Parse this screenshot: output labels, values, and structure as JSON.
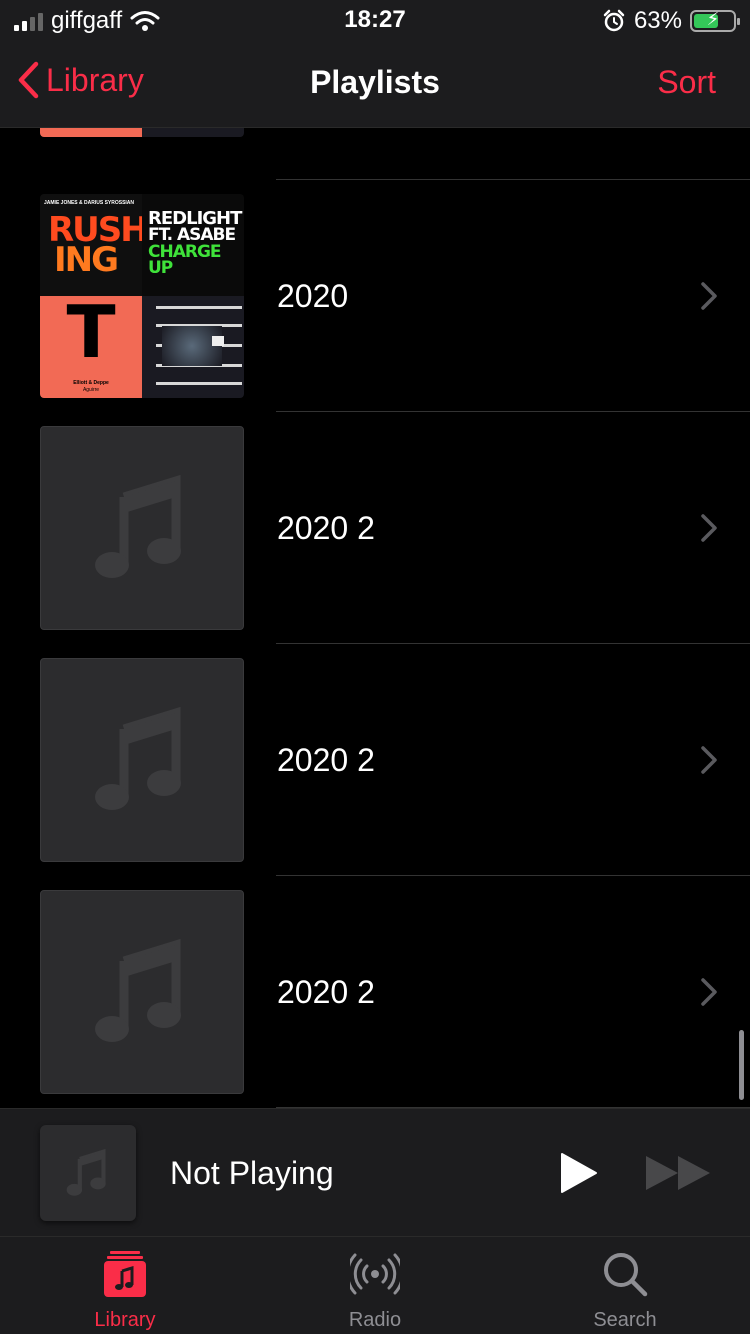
{
  "status_bar": {
    "carrier": "giffgaff",
    "time": "18:27",
    "battery_percent": "63%",
    "battery_level": 0.63
  },
  "nav": {
    "back_label": "Library",
    "title": "Playlists",
    "sort_label": "Sort"
  },
  "playlists": [
    {
      "title": "2020",
      "art": "mosaic"
    },
    {
      "title": "2020 2",
      "art": "placeholder"
    },
    {
      "title": "2020 2",
      "art": "placeholder"
    },
    {
      "title": "2020 2",
      "art": "placeholder"
    }
  ],
  "artwork_text": {
    "tile1_header": "JAMIE JONES & DARIUS SYROSSIAN",
    "tile1_word_a": "RUSH",
    "tile1_word_b": "ING",
    "tile2_line1": "REDLIGHT",
    "tile2_line2": "FT. ASABE",
    "tile2_line3": "CHARGE",
    "tile2_line4": "UP",
    "tile3_letter": "T",
    "tile3_caption": "Elliott & Deppe",
    "tile3_subcaption": "Aguirre"
  },
  "mini_player": {
    "title": "Not Playing"
  },
  "tabs": [
    {
      "label": "Library",
      "icon": "library-icon",
      "active": true
    },
    {
      "label": "Radio",
      "icon": "radio-icon",
      "active": false
    },
    {
      "label": "Search",
      "icon": "search-icon",
      "active": false
    }
  ],
  "colors": {
    "accent": "#fa2d48",
    "background": "#000000",
    "bar_background": "#1c1c1e",
    "placeholder_art": "#2c2c2e",
    "battery_fill": "#34c759"
  }
}
